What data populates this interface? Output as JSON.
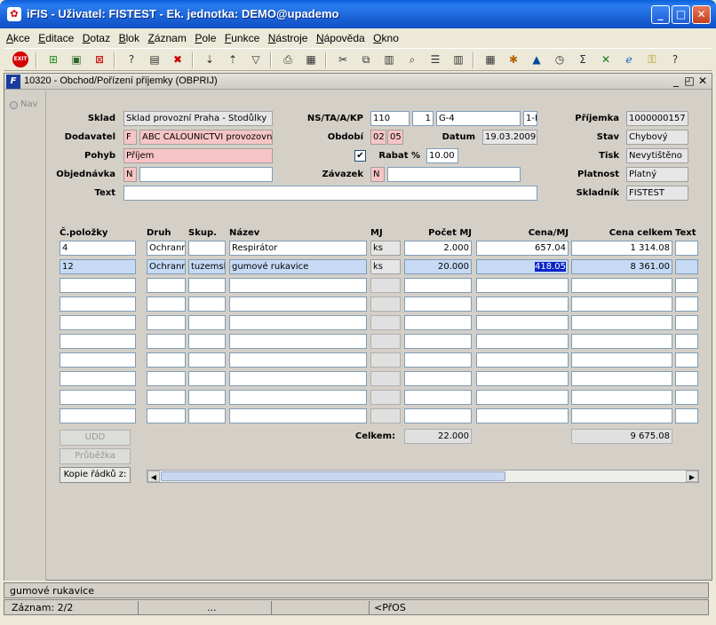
{
  "window": {
    "title": "iFIS - Uživatel: FISTEST - Ek. jednotka: DEMO@upademo",
    "app_icon": "ifis-app-icon",
    "controls": [
      "minimize-icon",
      "maximize-icon",
      "close-icon"
    ],
    "minimize_glyph": "_",
    "maximize_glyph": "□",
    "close_glyph": "✕"
  },
  "menu": [
    "Akce",
    "Editace",
    "Dotaz",
    "Blok",
    "Záznam",
    "Pole",
    "Funkce",
    "Nástroje",
    "Nápověda",
    "Okno"
  ],
  "toolbar": {
    "exit_label": "EXIT",
    "icons": [
      "insert-record-icon",
      "save-icon",
      "delete-record-icon",
      "query-icon",
      "execute-query-icon",
      "cancel-query-icon",
      "sort-asc-icon",
      "sort-desc-icon",
      "filter-icon",
      "print-icon",
      "print-preview-icon",
      "cut-icon",
      "copy-icon",
      "paste-icon",
      "find-icon",
      "list-icon",
      "columns-icon",
      "calculator-icon",
      "settings-icon",
      "warning-icon",
      "clock-icon",
      "sum-icon",
      "excel-icon",
      "ie-icon",
      "help-key-icon",
      "help-icon"
    ]
  },
  "form": {
    "title": "10320 - Obchod/Pořízení příjemky (OBPRIJ)",
    "nav_label": "Nav",
    "header": {
      "sklad_label": "Sklad",
      "sklad_value": "Sklad provozní Praha - Stodůlky",
      "dodavatel_label": "Dodavatel",
      "dodavatel_code": "F",
      "dodavatel_value": "ABC CALOUNICTVI provozovn",
      "pohyb_label": "Pohyb",
      "pohyb_value": "Příjem",
      "objednavka_label": "Objednávka",
      "objednavka_code": "N",
      "objednavka_value": "",
      "text_label": "Text",
      "text_value": "",
      "ns_label": "NS/TA/A/KP",
      "ns_value": "110",
      "ta_value": "1",
      "a_value": "G-4",
      "kp_value": "1-I",
      "obdobi_label": "Období",
      "obdobi_m": "02",
      "obdobi_y": "05",
      "datum_label": "Datum",
      "datum_value": "19.03.2009",
      "rabat_check": "✔",
      "rabat_label": "Rabat %",
      "rabat_value": "10.00",
      "zavazek_label": "Závazek",
      "zavazek_code": "N",
      "zavazek_value": "",
      "prijemka_label": "Příjemka",
      "prijemka_value": "1000000157",
      "stav_label": "Stav",
      "stav_value": "Chybový",
      "tisk_label": "Tisk",
      "tisk_value": "Nevytištěno",
      "platnost_label": "Platnost",
      "platnost_value": "Platný",
      "skladnik_label": "Skladník",
      "skladnik_value": "FISTEST"
    },
    "columns": [
      "Č.položky",
      "Druh",
      "Skup.",
      "Název",
      "MJ",
      "Počet MJ",
      "Cena/MJ",
      "Cena celkem",
      "Text"
    ],
    "rows": [
      {
        "cpol": "4",
        "druh": "Ochranr",
        "skup": "",
        "nazev": "Respirátor",
        "mj": "ks",
        "pocet": "2.000",
        "cena": "657.04",
        "celkem": "1 314.08",
        "text": ""
      },
      {
        "cpol": "12",
        "druh": "Ochranr",
        "skup": "tuzemsk",
        "nazev": "gumové rukavice",
        "mj": "ks",
        "pocet": "20.000",
        "cena": "418.05",
        "celkem": "8 361.00",
        "text": ""
      }
    ],
    "empty_rows": 8,
    "totals": {
      "label": "Celkem:",
      "pocet": "22.000",
      "celkem": "9 675.08"
    },
    "buttons": {
      "udd": "UDD",
      "pruvodka": "Průběžka",
      "kopie": "Kopie řádků z:"
    }
  },
  "status": {
    "hint": "gumové rukavice",
    "record": "Záznam: 2/2",
    "ellipsis": "...",
    "mode": "<PřOS"
  }
}
